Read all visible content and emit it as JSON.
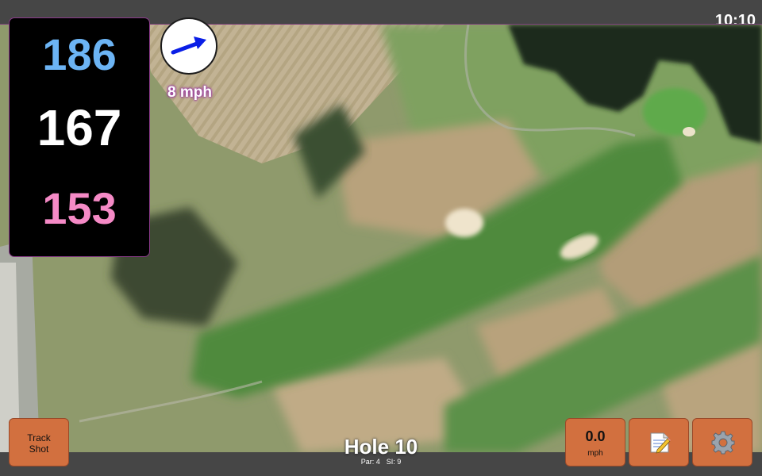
{
  "status_bar": {
    "time": "10:10"
  },
  "distances": {
    "back": "186",
    "middle": "167",
    "front": "153"
  },
  "wind": {
    "speed_label": "8 mph",
    "direction_icon": "arrow-icon"
  },
  "hole": {
    "title": "Hole 10",
    "par_label": "Par: 4",
    "si_label": "SI: 9"
  },
  "buttons": {
    "track_shot_line1": "Track",
    "track_shot_line2": "Shot",
    "speed_value": "0.0",
    "speed_unit": "mph",
    "notes_icon": "memo-icon",
    "settings_icon": "gear-icon"
  },
  "colors": {
    "back_distance": "#6cb4f4",
    "middle_distance": "#ffffff",
    "front_distance": "#f58ac6",
    "button_orange": "#d2703f",
    "wind_arrow": "#0a1ee6"
  }
}
